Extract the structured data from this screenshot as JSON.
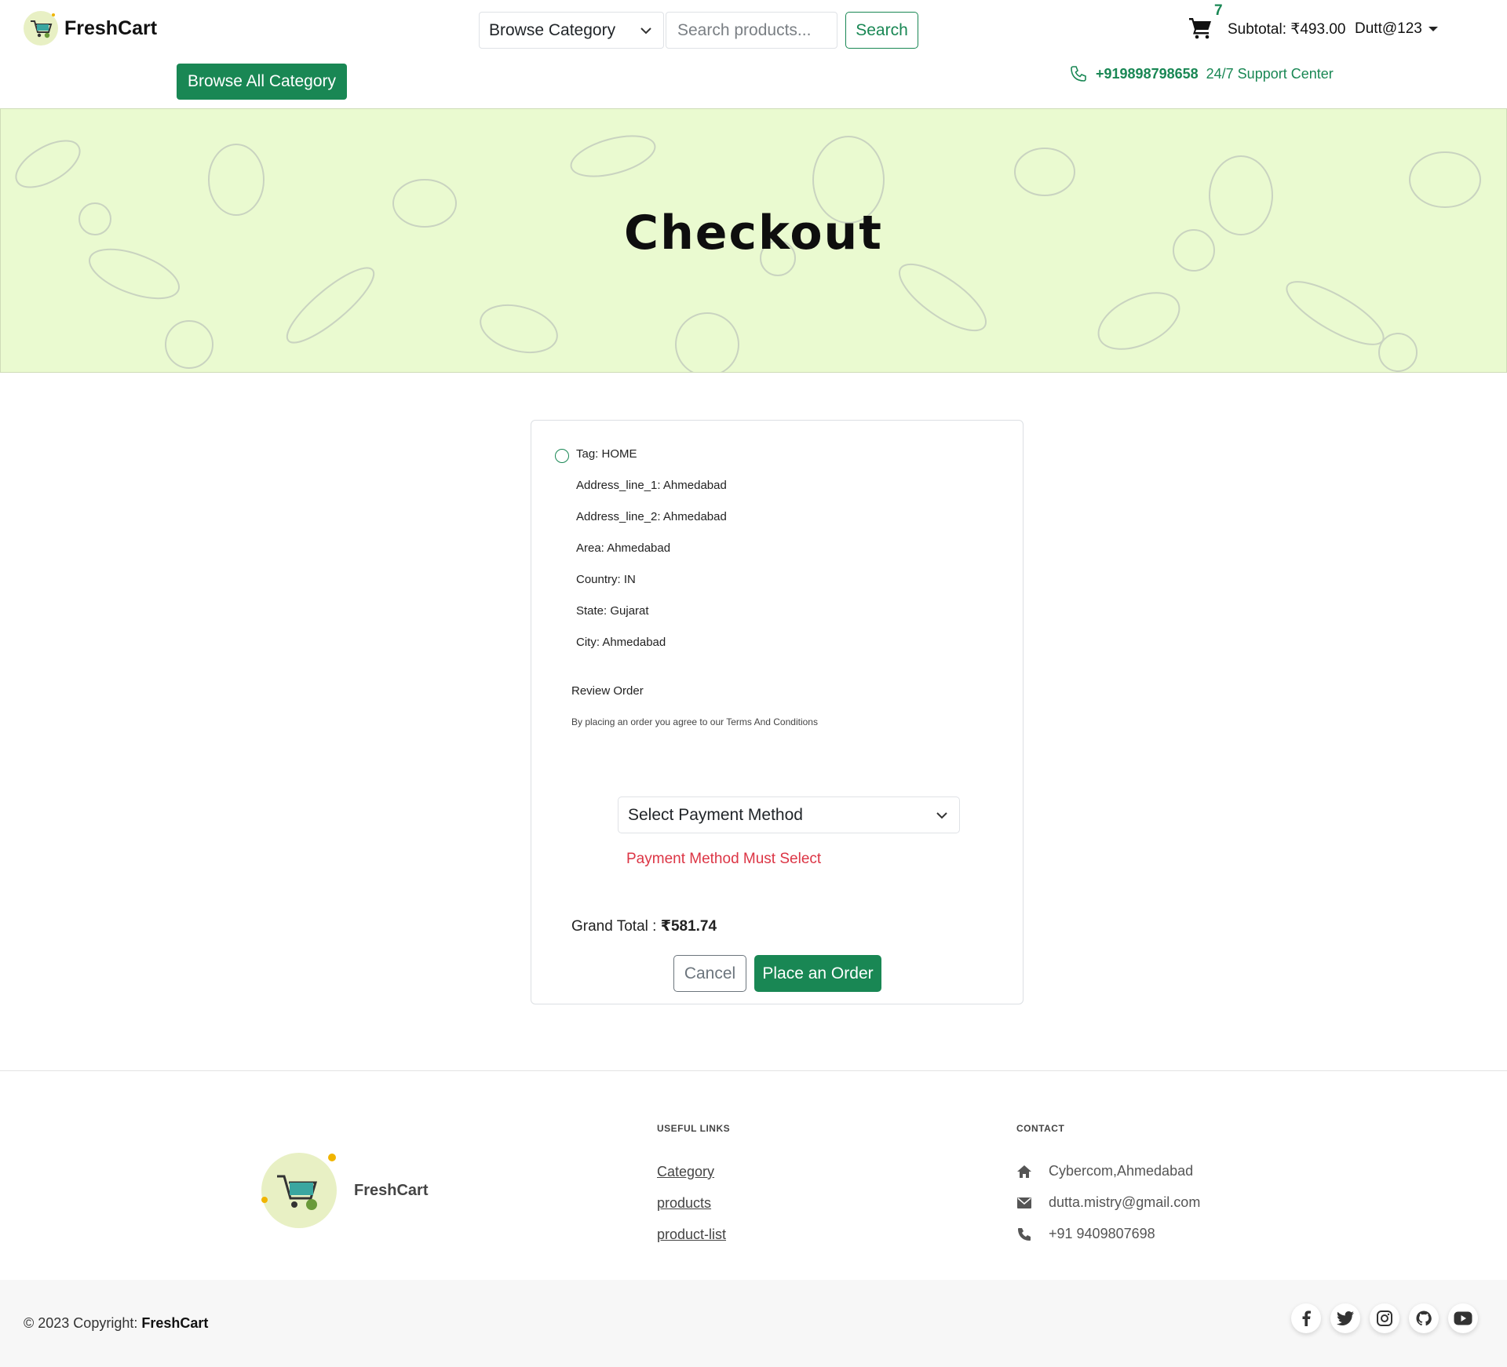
{
  "brand": {
    "name": "FreshCart"
  },
  "header": {
    "category_select": "Browse Category",
    "search_placeholder": "Search products...",
    "search_label": "Search",
    "cart_count": "7",
    "subtotal": "Subtotal: ₹493.00",
    "user": "Dutt@123",
    "browse_all": "Browse All Category",
    "phone": "+919898798658",
    "support": "24/7 Support Center"
  },
  "hero": {
    "title": "Checkout"
  },
  "address": {
    "tag": "Tag: HOME",
    "line1": "Address_line_1: Ahmedabad",
    "line2": "Address_line_2: Ahmedabad",
    "area": "Area: Ahmedabad",
    "country": "Country: IN",
    "state": "State: Gujarat",
    "city": "City: Ahmedabad"
  },
  "review": {
    "title": "Review Order",
    "terms": "By placing an order you agree to our Terms And Conditions"
  },
  "payment": {
    "select_label": "Select Payment Method",
    "error": "Payment Method Must Select"
  },
  "total": {
    "label": "Grand Total : ",
    "value": "₹581.74"
  },
  "actions": {
    "cancel": "Cancel",
    "place_order": "Place an Order"
  },
  "footer": {
    "brand": "FreshCart",
    "useful_links_heading": "USEFUL LINKS",
    "links": [
      "Category",
      "products",
      "product-list"
    ],
    "contact_heading": "CONTACT",
    "address": "Cybercom,Ahmedabad",
    "email": "dutta.mistry@gmail.com",
    "phone": "+91 9409807698",
    "copyright_prefix": "© 2023 Copyright: ",
    "copyright_brand": "FreshCart",
    "social": [
      "facebook-icon",
      "twitter-icon",
      "instagram-icon",
      "github-icon",
      "youtube-icon"
    ]
  },
  "colors": {
    "primary": "#198754",
    "error": "#dc3545",
    "hero_bg": "#eafad0"
  }
}
